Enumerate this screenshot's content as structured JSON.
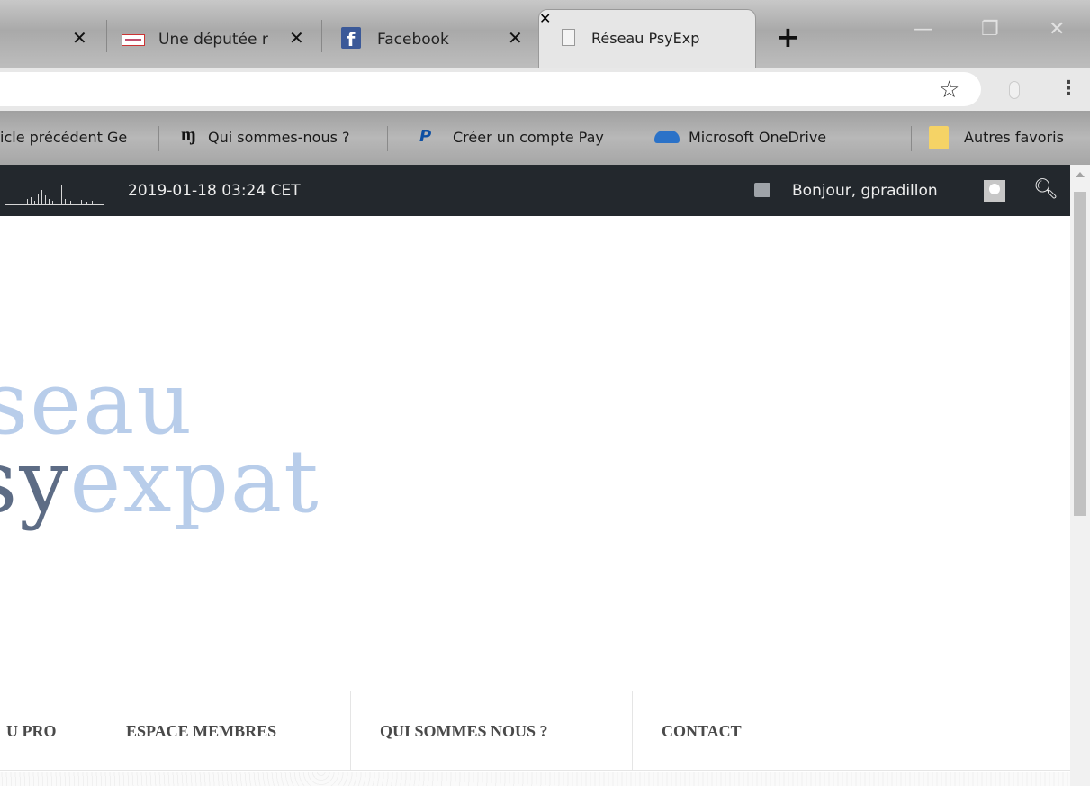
{
  "browser": {
    "tabs": [
      {
        "label": "",
        "active": false
      },
      {
        "label": "Une députée r",
        "active": false
      },
      {
        "label": "Facebook",
        "active": false
      },
      {
        "label": "Réseau PsyExp",
        "active": true
      }
    ],
    "bookmarks": [
      {
        "label": "icle précédent Ge"
      },
      {
        "label": "Qui sommes-nous ?"
      },
      {
        "label": "Créer un compte Pay"
      },
      {
        "label": "Microsoft OneDrive"
      },
      {
        "label": "Autres favoris"
      }
    ],
    "icons": [
      "close-icon",
      "facebook-icon",
      "page-icon",
      "new-tab-icon",
      "star-icon",
      "menu-icon",
      "folder-icon"
    ]
  },
  "adminbar": {
    "datetime": "2019-01-18 03:24 CET",
    "greeting": "Bonjour, gpradillon"
  },
  "logo": {
    "line1": "seau",
    "line2_dark": "sy",
    "line2_light": "expat"
  },
  "nav": {
    "items": [
      {
        "label": "U PRO"
      },
      {
        "label": "ESPACE MEMBRES"
      },
      {
        "label": "QUI SOMMES NOUS ?"
      },
      {
        "label": "CONTACT"
      }
    ]
  },
  "colors": {
    "adminbar_bg": "#23282d",
    "logo_light": "#b8cdea",
    "logo_dark": "#5d6c85",
    "nav_text": "#4a4a4a"
  }
}
